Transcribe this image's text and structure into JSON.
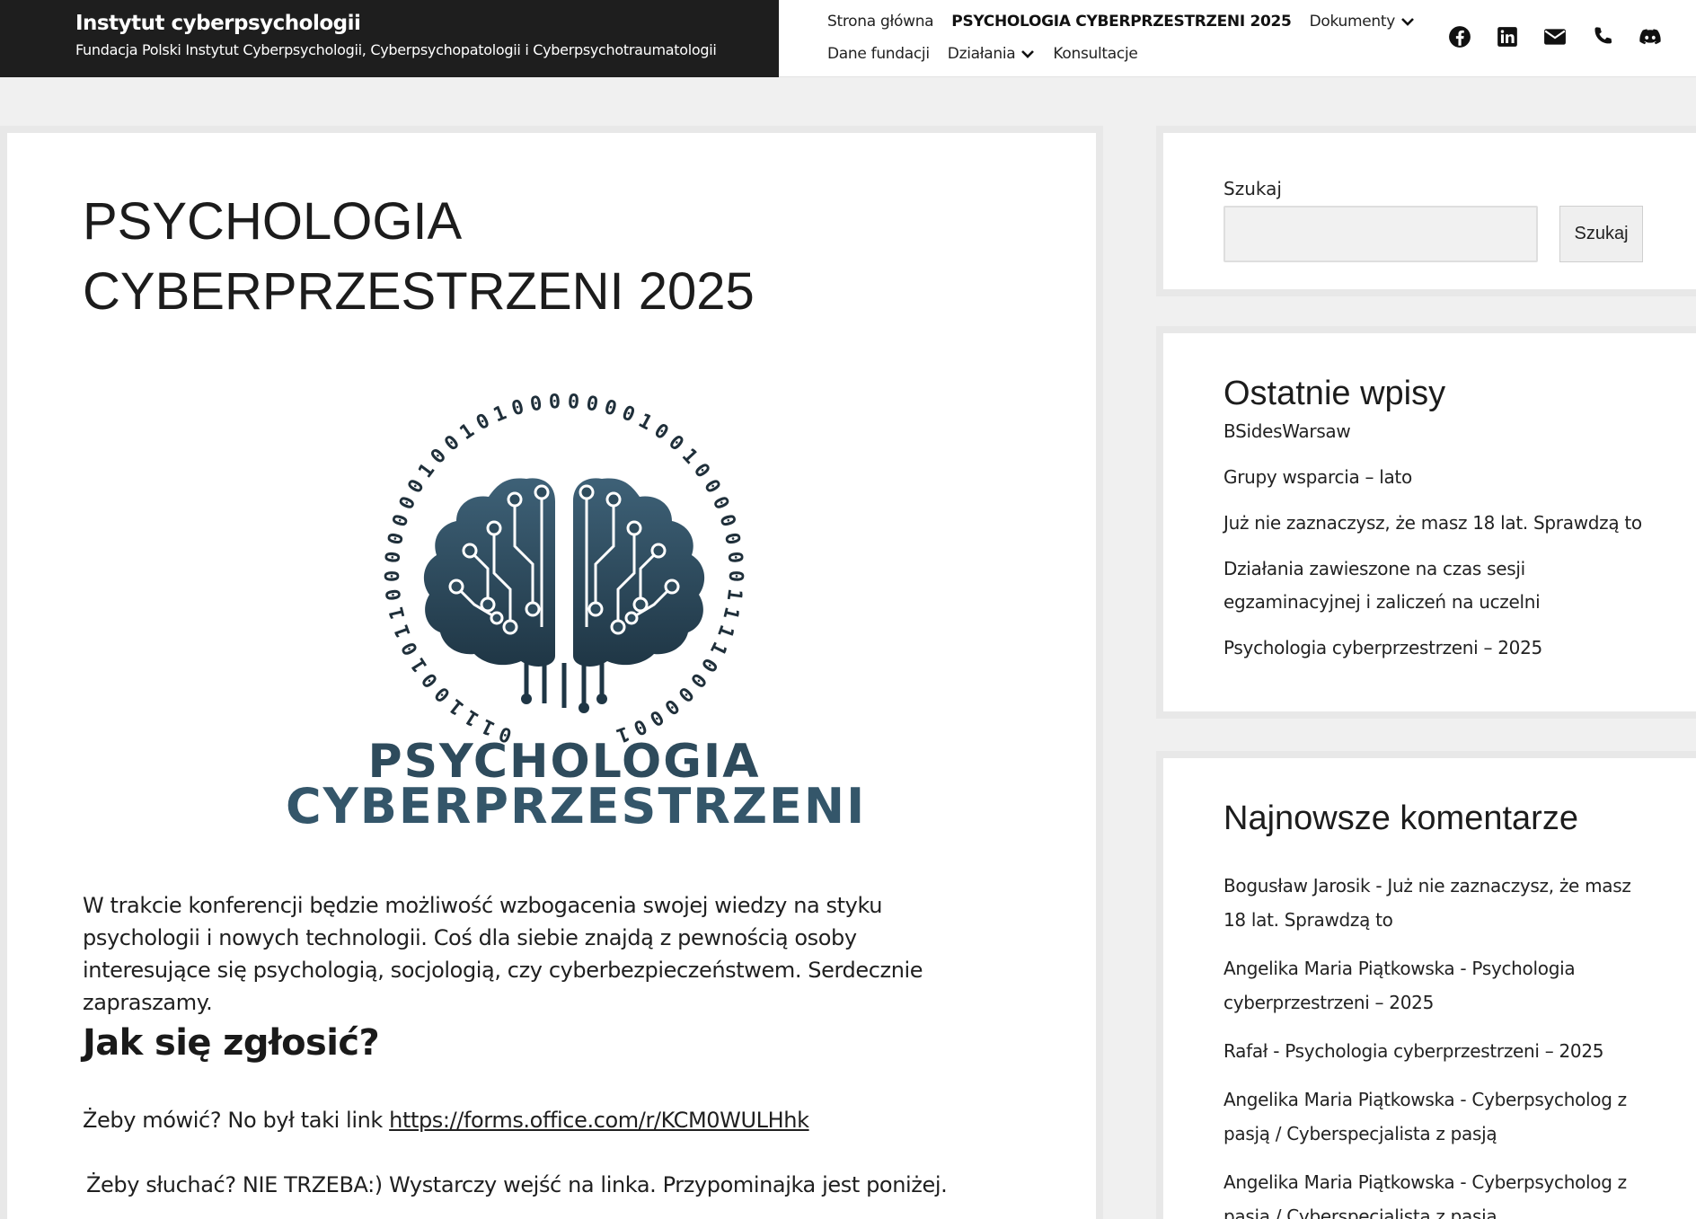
{
  "brand": {
    "title": "Instytut cyberpsychologii",
    "subtitle": "Fundacja Polski Instytut Cyberpsychologii, Cyberpsychopatologii i Cyberpsychotraumatologii"
  },
  "nav": {
    "row1": [
      {
        "label": "Strona główna"
      },
      {
        "label": "PSYCHOLOGIA CYBERPRZESTRZENI 2025",
        "current": true
      },
      {
        "label": "Dokumenty",
        "has_dropdown": true
      }
    ],
    "row2": [
      {
        "label": "Dane fundacji"
      },
      {
        "label": "Działania",
        "has_dropdown": true
      },
      {
        "label": "Konsultacje"
      }
    ],
    "socials": [
      "facebook-icon",
      "linkedin-icon",
      "email-icon",
      "phone-icon",
      "discord-icon"
    ]
  },
  "main": {
    "title": "PSYCHOLOGIA CYBERPRZESTRZENI 2025",
    "logo": {
      "binary": "0111001011000000010010100000001001000000011110000001",
      "line1": "PSYCHOLOGIA",
      "line2": "CYBERPRZESTRZENI",
      "color": "#2e4b5c"
    },
    "intro": "W trakcie konferencji będzie możliwość wzbogacenia swojej wiedzy na styku psychologii i nowych technologii. Coś dla siebie znajdą z pewnością osoby interesujące się psychologią, socjologią, czy cyberbezpieczeństwem. Serdecznie zapraszamy.",
    "apply_heading": "Jak się zgłosić?",
    "speak_prefix": "Żeby mówić? No był taki link ",
    "speak_link": "https://forms.office.com/r/KCM0WULHhk",
    "listen_text": "Żeby słuchać? NIE TRZEBA:) Wystarczy wejść na linka. Przypominajka jest poniżej."
  },
  "sidebar": {
    "search": {
      "label": "Szukaj",
      "button": "Szukaj",
      "value": ""
    },
    "recent_posts": {
      "heading": "Ostatnie wpisy",
      "items": [
        "BSidesWarsaw",
        "Grupy wsparcia – lato",
        "Już nie zaznaczysz, że masz 18 lat. Sprawdzą to",
        "Działania zawieszone na czas sesji egzaminacyjnej i zaliczeń na uczelni",
        "Psychologia cyberprzestrzeni – 2025"
      ]
    },
    "recent_comments": {
      "heading": "Najnowsze komentarze",
      "items": [
        {
          "author": "Bogusław Jarosik",
          "post": "Już nie zaznaczysz, że masz 18 lat. Sprawdzą to"
        },
        {
          "author": "Angelika Maria Piątkowska",
          "post": "Psychologia cyberprzestrzeni – 2025"
        },
        {
          "author": "Rafał",
          "post": "Psychologia cyberprzestrzeni – 2025"
        },
        {
          "author": "Angelika Maria Piątkowska",
          "post": "Cyberpsycholog z pasją / Cyberspecjalista z pasją"
        },
        {
          "author": "Angelika Maria Piątkowska",
          "post": "Cyberpsycholog z pasją / Cyberspecjalista z pasją"
        }
      ]
    }
  }
}
